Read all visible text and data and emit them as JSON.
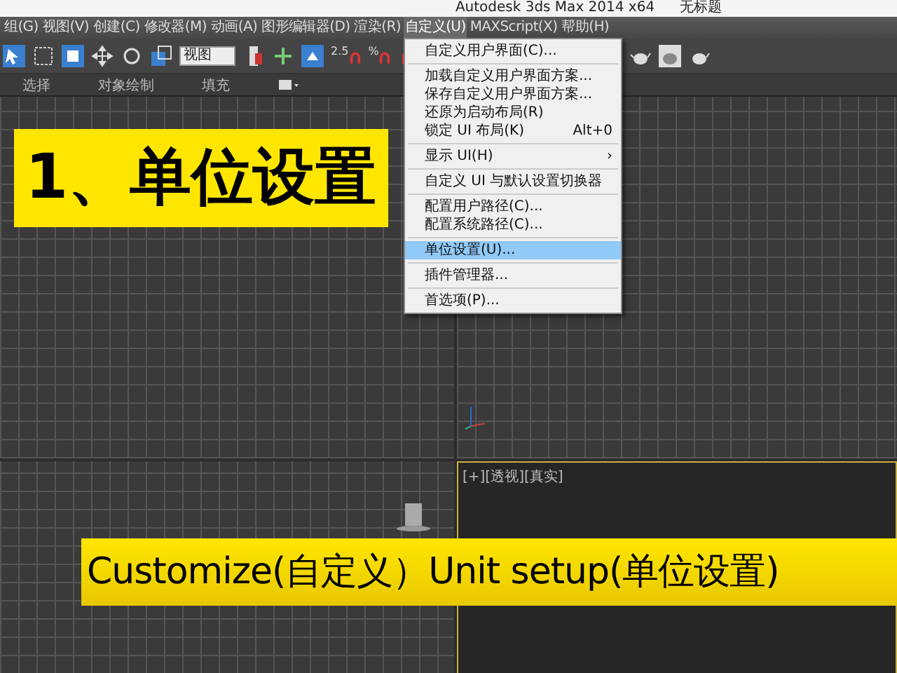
{
  "window": {
    "title": "Autodesk 3ds Max  2014 x64",
    "document": "无标题"
  },
  "menu_bar": [
    {
      "label": "组(G)",
      "selected": false
    },
    {
      "label": "视图(V)",
      "selected": false
    },
    {
      "label": "创建(C)",
      "selected": false
    },
    {
      "label": "修改器(M)",
      "selected": false
    },
    {
      "label": "动画(A)",
      "selected": false
    },
    {
      "label": "图形编辑器(D)",
      "selected": false
    },
    {
      "label": "渲染(R)",
      "selected": false
    },
    {
      "label": "自定义(U)",
      "selected": true
    },
    {
      "label": "MAXScript(X)",
      "selected": false
    },
    {
      "label": "帮助(H)",
      "selected": false
    }
  ],
  "toolbar": {
    "view_dropdown": "视图",
    "snap_labels": [
      "2.5",
      "%"
    ]
  },
  "ribbon_tabs": [
    {
      "label": "选择"
    },
    {
      "label": "对象绘制"
    },
    {
      "label": "填充"
    }
  ],
  "dropdown_menu": [
    {
      "kind": "item",
      "label": "自定义用户界面(C)...",
      "selected": false
    },
    {
      "kind": "separator"
    },
    {
      "kind": "item",
      "label": "加载自定义用户界面方案...",
      "selected": false
    },
    {
      "kind": "item",
      "label": "保存自定义用户界面方案...",
      "selected": false
    },
    {
      "kind": "item",
      "label": "还原为启动布局(R)",
      "selected": false
    },
    {
      "kind": "item",
      "label": "锁定 UI 布局(K)",
      "shortcut": "Alt+0",
      "selected": false
    },
    {
      "kind": "separator"
    },
    {
      "kind": "submenu",
      "label": "显示 UI(H)",
      "arrow": "›",
      "selected": false
    },
    {
      "kind": "separator"
    },
    {
      "kind": "item",
      "label": "自定义 UI 与默认设置切换器",
      "selected": false
    },
    {
      "kind": "separator"
    },
    {
      "kind": "item",
      "label": "配置用户路径(C)...",
      "selected": false
    },
    {
      "kind": "item",
      "label": "配置系统路径(C)...",
      "selected": false
    },
    {
      "kind": "separator"
    },
    {
      "kind": "item",
      "label": "单位设置(U)...",
      "selected": true
    },
    {
      "kind": "separator"
    },
    {
      "kind": "item",
      "label": "插件管理器...",
      "selected": false
    },
    {
      "kind": "separator"
    },
    {
      "kind": "item",
      "label": "首选项(P)...",
      "selected": false
    }
  ],
  "viewports": [
    {
      "active": false
    },
    {
      "active": false
    },
    {
      "active": false
    },
    {
      "label": "[+][透视][真实]",
      "active": true
    }
  ],
  "captions": {
    "heading": "1、单位设置",
    "subtitle": "Customize(自定义）Unit setup(单位设置)"
  }
}
